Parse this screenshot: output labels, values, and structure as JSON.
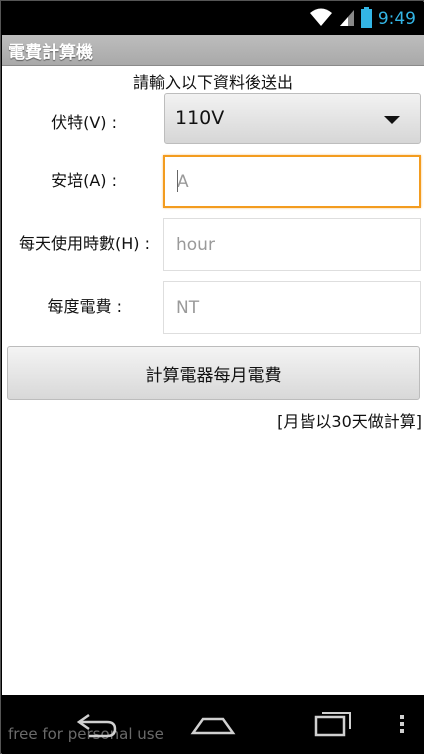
{
  "status_bar": {
    "time": "9:49",
    "icons": [
      "wifi-icon",
      "signal-icon",
      "battery-icon"
    ]
  },
  "app": {
    "title": "電費計算機"
  },
  "form": {
    "instruction": "請輸入以下資料後送出",
    "voltage": {
      "label": "伏特(V) :",
      "selected": "110V"
    },
    "current": {
      "label": "安培(A) :",
      "placeholder": "A"
    },
    "hours": {
      "label": "每天使用時數(H) :",
      "placeholder": "hour"
    },
    "rate": {
      "label": "每度電費 :",
      "placeholder": "NT"
    }
  },
  "calculate_button": {
    "label": "計算電器每月電費"
  },
  "note": "[月皆以30天做計算]",
  "nav_bar": {
    "watermark": "free for personal use",
    "icons": [
      "back-icon",
      "home-icon",
      "recent-apps-icon",
      "overflow-menu-icon"
    ]
  },
  "colors": {
    "accent": "#33b5e5",
    "focus": "#f39c1f",
    "action_bar": "#b3b3b3"
  }
}
